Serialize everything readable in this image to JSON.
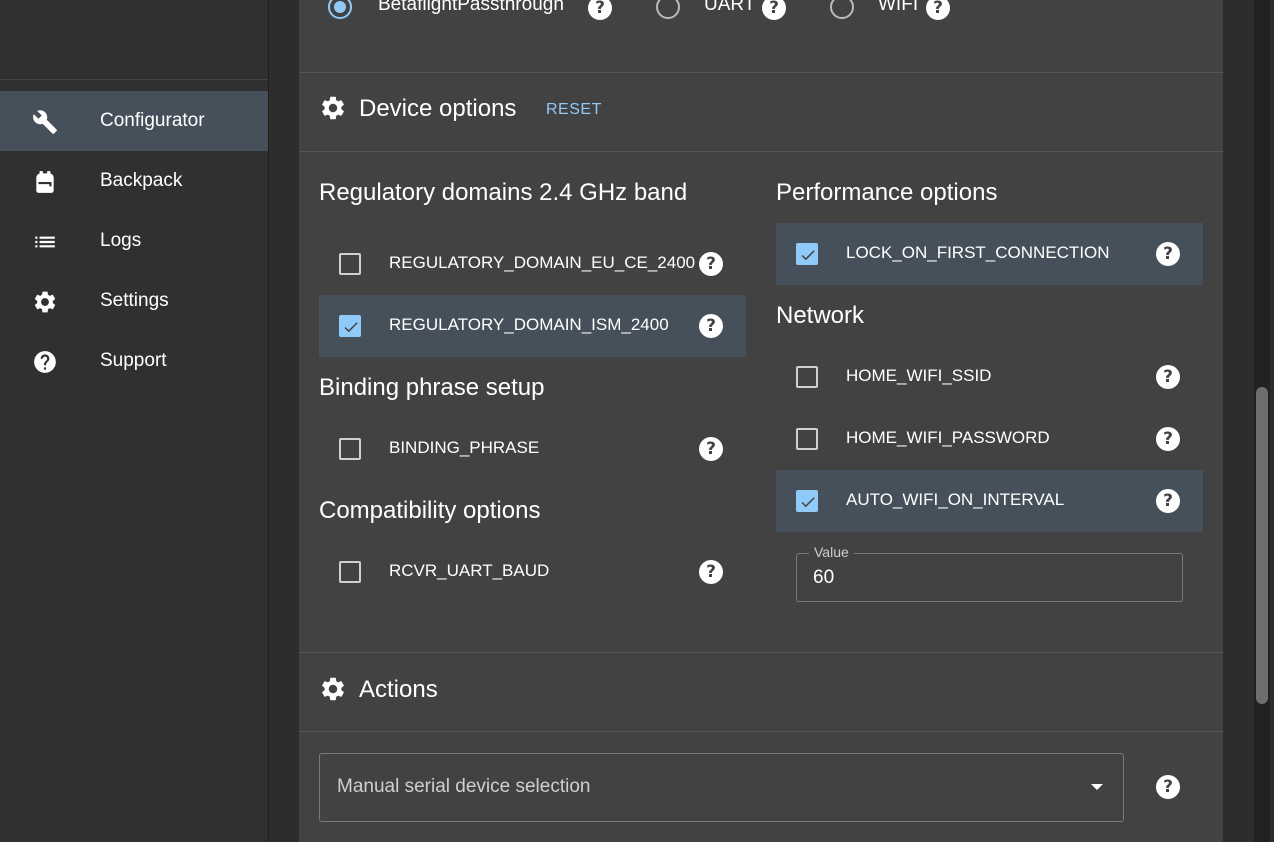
{
  "sidebar": {
    "items": [
      {
        "label": "Configurator",
        "icon": "wrench-icon",
        "active": true
      },
      {
        "label": "Backpack",
        "icon": "backpack-icon",
        "active": false
      },
      {
        "label": "Logs",
        "icon": "list-icon",
        "active": false
      },
      {
        "label": "Settings",
        "icon": "gear-icon",
        "active": false
      },
      {
        "label": "Support",
        "icon": "help-circle-icon",
        "active": false
      }
    ]
  },
  "flashing_method": {
    "options": [
      {
        "label": "BetaflightPassthrough",
        "selected": true
      },
      {
        "label": "UART",
        "selected": false
      },
      {
        "label": "WIFI",
        "selected": false
      }
    ]
  },
  "device_options": {
    "title": "Device options",
    "reset_label": "RESET",
    "regulatory": {
      "title": "Regulatory domains 2.4 GHz band",
      "items": [
        {
          "label": "REGULATORY_DOMAIN_EU_CE_2400",
          "checked": false
        },
        {
          "label": "REGULATORY_DOMAIN_ISM_2400",
          "checked": true
        }
      ]
    },
    "binding": {
      "title": "Binding phrase setup",
      "items": [
        {
          "label": "BINDING_PHRASE",
          "checked": false
        }
      ]
    },
    "compatibility": {
      "title": "Compatibility options",
      "items": [
        {
          "label": "RCVR_UART_BAUD",
          "checked": false
        }
      ]
    },
    "performance": {
      "title": "Performance options",
      "items": [
        {
          "label": "LOCK_ON_FIRST_CONNECTION",
          "checked": true
        }
      ]
    },
    "network": {
      "title": "Network",
      "items": [
        {
          "label": "HOME_WIFI_SSID",
          "checked": false
        },
        {
          "label": "HOME_WIFI_PASSWORD",
          "checked": false
        },
        {
          "label": "AUTO_WIFI_ON_INTERVAL",
          "checked": true
        }
      ],
      "value_field": {
        "legend": "Value",
        "value": "60"
      }
    }
  },
  "actions": {
    "title": "Actions",
    "serial_select": {
      "placeholder": "Manual serial device selection"
    }
  },
  "colors": {
    "accent": "#90caf9",
    "panel": "#424242",
    "selected_row": "#45505a"
  }
}
